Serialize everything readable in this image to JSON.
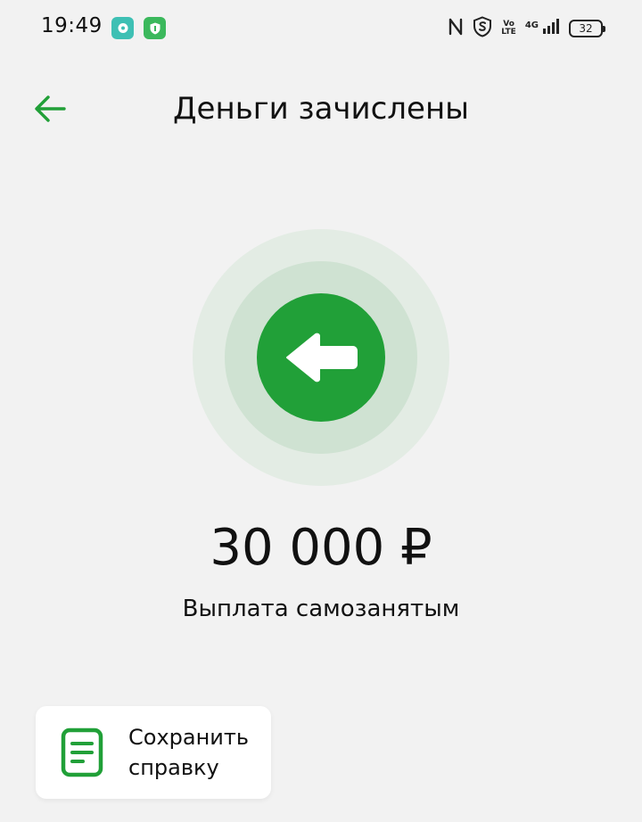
{
  "status_bar": {
    "time": "19:49",
    "network_label": "4G",
    "volte_line1": "Vo",
    "volte_line2": "LTE",
    "battery_level": "32",
    "icons": [
      "chat-app-icon",
      "shield-app-icon",
      "nfc-icon",
      "s-shield-icon",
      "volte-icon",
      "signal-icon",
      "battery-icon"
    ]
  },
  "header": {
    "title": "Деньги зачислены",
    "back_icon": "arrow-left-icon"
  },
  "hero": {
    "icon": "arrow-left-bold-icon",
    "accent_color": "#21a038"
  },
  "transaction": {
    "amount": "30 000 ₽",
    "description": "Выплата самозанятым"
  },
  "actions": {
    "save_receipt": {
      "label": "Сохранить справку",
      "icon": "document-icon"
    }
  }
}
